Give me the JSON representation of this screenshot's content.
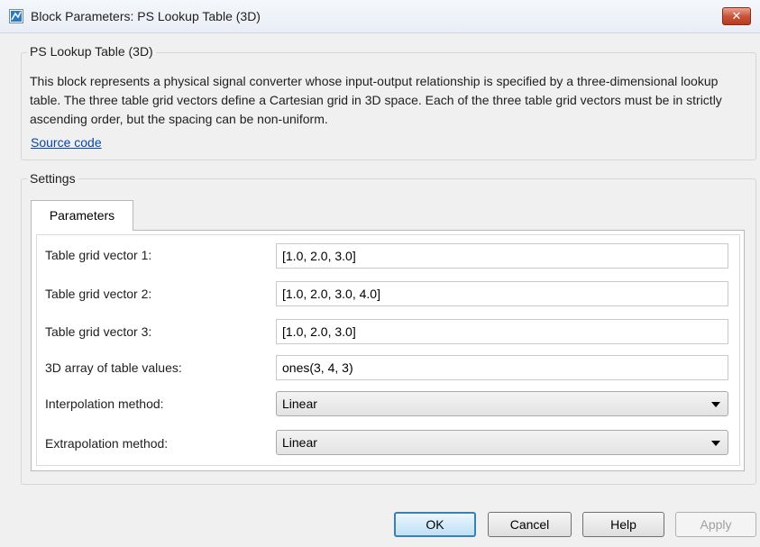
{
  "window": {
    "title": "Block Parameters: PS Lookup Table (3D)",
    "close_label": "✕"
  },
  "description": {
    "legend": "PS Lookup Table (3D)",
    "text": "This block represents a physical signal converter whose input-output relationship is specified by a three-dimensional lookup table. The three table grid vectors define a Cartesian grid in 3D space. Each of the three table grid vectors must be in strictly ascending order, but the spacing can be non-uniform.",
    "source_link": "Source code"
  },
  "settings": {
    "legend": "Settings",
    "tab_label": "Parameters",
    "rows": [
      {
        "label": "Table grid vector 1:",
        "value": "[1.0, 2.0, 3.0]"
      },
      {
        "label": "Table grid vector 2:",
        "value": "[1.0, 2.0, 3.0, 4.0]"
      },
      {
        "label": "Table grid vector 3:",
        "value": "[1.0, 2.0, 3.0]"
      },
      {
        "label": "3D array of table values:",
        "value": "ones(3, 4, 3)"
      }
    ],
    "selects": [
      {
        "label": "Interpolation method:",
        "value": "Linear"
      },
      {
        "label": "Extrapolation method:",
        "value": "Linear"
      }
    ]
  },
  "buttons": {
    "ok": "OK",
    "cancel": "Cancel",
    "help": "Help",
    "apply": "Apply"
  },
  "colors": {
    "link": "#0645ad",
    "close_button": "#c9553b",
    "ok_border": "#3c7fb1"
  }
}
